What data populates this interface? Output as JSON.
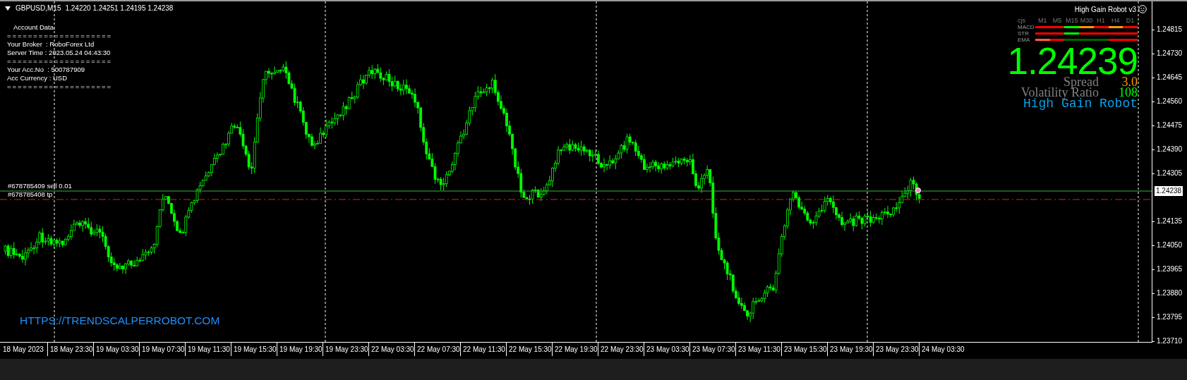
{
  "chart_header": {
    "symbol": "GBPUSD,M15",
    "quote": "1.24220 1.24251 1.24195 1.24238"
  },
  "account_panel": {
    "title": "Account Data.",
    "lines": [
      {
        "kind": "rule",
        "text": "===================="
      },
      {
        "kind": "field",
        "text": "Your Broker  : RoboForex Ltd"
      },
      {
        "kind": "field",
        "text": "Server Time : 2023.05.24 04:43:30"
      },
      {
        "kind": "rule",
        "text": "===================="
      },
      {
        "kind": "field",
        "text": "Your Acc.No  : 500787909"
      },
      {
        "kind": "field",
        "text": "Acc Currency : USD"
      },
      {
        "kind": "rule",
        "text": "===================="
      }
    ]
  },
  "order_lines": [
    {
      "kind": "sell",
      "text": "#678785409 sell 0.01"
    },
    {
      "kind": "tp",
      "text": "#678785408 tp"
    }
  ],
  "robot_panel": {
    "title": "High Gain Robot v3",
    "corner": "cjs",
    "timeframes": [
      "M1",
      "M5",
      "M15",
      "M30",
      "H1",
      "H4",
      "D1"
    ],
    "rows": [
      {
        "label": "MACD",
        "cells": [
          {
            "color": "#ff0000"
          },
          {
            "color": "#ff0000"
          },
          {
            "color": "#00ff00"
          },
          {
            "color": "#ff9900"
          },
          {
            "color": "#ff0000"
          },
          {
            "color": "#ff9900"
          },
          {
            "color": "#ff0000"
          }
        ]
      },
      {
        "label": "STR",
        "cells": [
          {
            "color": "#ff0000"
          },
          {
            "color": "#ff0000"
          },
          {
            "color": "#00ff00"
          },
          {
            "color": "#ff0000"
          },
          {
            "color": "#ff0000"
          },
          {
            "color": "#ff0000"
          },
          {
            "color": "#ff0000"
          }
        ]
      },
      {
        "label": "EMA",
        "cells": [
          {
            "color": "#ff6040"
          },
          {
            "color": "#ff0000"
          },
          {
            "color": "#006400"
          },
          {
            "color": "#006400"
          },
          {
            "color": "#006400"
          },
          {
            "color": "#ff0000"
          },
          {
            "color": "#ff0000"
          }
        ]
      }
    ],
    "price": "1.24239",
    "stats": [
      {
        "label": "Spread",
        "value": "3.0",
        "color": "#ff9900"
      },
      {
        "label": "Volatility Ratio",
        "value": "108",
        "color": "#00ff00"
      }
    ],
    "brand": "High Gain Robot"
  },
  "website_label": "HTTPS://TRENDSCALPERROBOT.COM",
  "price_axis": {
    "ticks": [
      "1.24815",
      "1.24730",
      "1.24645",
      "1.24560",
      "1.24475",
      "1.24390",
      "1.24305",
      "1.24135",
      "1.24050",
      "1.23965",
      "1.23880",
      "1.23795",
      "1.23710"
    ],
    "current_price": "1.24238"
  },
  "time_axis": [
    "18 May 2023",
    "18 May 23:30",
    "19 May 03:30",
    "19 May 07:30",
    "19 May 11:30",
    "19 May 15:30",
    "19 May 19:30",
    "19 May 23:30",
    "22 May 03:30",
    "22 May 07:30",
    "22 May 11:30",
    "22 May 15:30",
    "22 May 19:30",
    "22 May 23:30",
    "23 May 03:30",
    "23 May 07:30",
    "23 May 11:30",
    "23 May 15:30",
    "23 May 19:30",
    "23 May 23:30",
    "24 May 03:30"
  ]
}
